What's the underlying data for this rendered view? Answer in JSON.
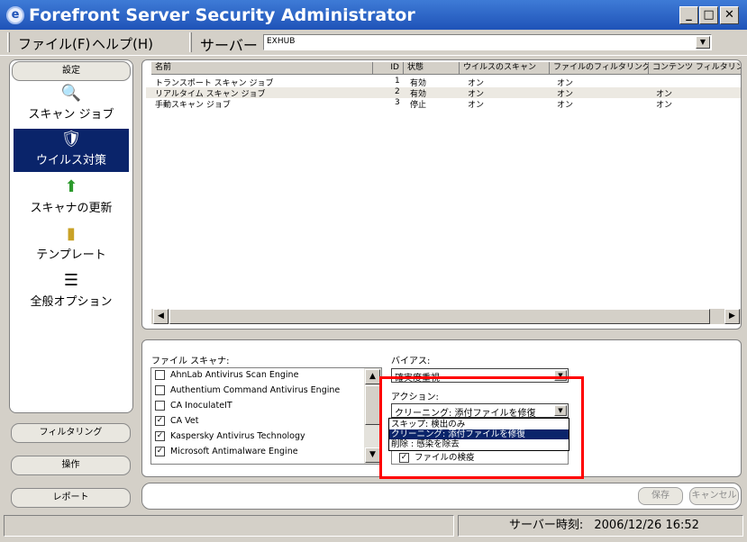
{
  "window": {
    "title": "Forefront Server Security Administrator",
    "min": "_",
    "max": "□",
    "close": "✕"
  },
  "menu": {
    "file": "ファイル(F)",
    "help": "ヘルプ(H)",
    "server_label": "サーバー",
    "server_value": "EXHUB"
  },
  "sidebar": {
    "settings_button": "設定",
    "nav": [
      {
        "label": "スキャン ジョブ",
        "icon": "scan-job-icon",
        "selected": false
      },
      {
        "label": "ウイルス対策",
        "icon": "antivirus-shield-icon",
        "selected": true
      },
      {
        "label": "スキャナの更新",
        "icon": "scanner-update-icon",
        "selected": false
      },
      {
        "label": "テンプレート",
        "icon": "template-icon",
        "selected": false
      },
      {
        "label": "全般オプション",
        "icon": "general-options-icon",
        "selected": false
      }
    ],
    "filtering_button": "フィルタリング",
    "operations_button": "操作",
    "report_button": "レポート"
  },
  "jobs": {
    "columns": [
      "名前",
      "ID",
      "状態",
      "ウイルスのスキャン",
      "ファイルのフィルタリング",
      "コンテンツ フィルタリング"
    ],
    "rows": [
      [
        "トランスポート スキャン ジョブ",
        "1",
        "有効",
        "オン",
        "オン",
        ""
      ],
      [
        "リアルタイム スキャン ジョブ",
        "2",
        "有効",
        "オン",
        "オン",
        "オン"
      ],
      [
        "手動スキャン ジョブ",
        "3",
        "停止",
        "オン",
        "オン",
        "オン"
      ]
    ]
  },
  "file_scanner": {
    "label": "ファイル スキャナ:",
    "engines": [
      {
        "name": "AhnLab Antivirus Scan Engine",
        "checked": false
      },
      {
        "name": "Authentium Command Antivirus Engine",
        "checked": false
      },
      {
        "name": "CA InoculateIT",
        "checked": false
      },
      {
        "name": "CA Vet",
        "checked": true
      },
      {
        "name": "Kaspersky Antivirus Technology",
        "checked": true
      },
      {
        "name": "Microsoft Antimalware Engine",
        "checked": true
      }
    ]
  },
  "bias": {
    "label": "バイアス:",
    "value": "確実度重視"
  },
  "action": {
    "label": "アクション:",
    "value": "クリーニング: 添付ファイルを修復",
    "options": [
      "スキップ: 検出のみ",
      "クリーニング: 添付ファイルを修復",
      "削除 : 感染を除去"
    ],
    "selected_index": 1
  },
  "partial_checkbox_label": "ファイルの検疫",
  "buttons": {
    "save": "保存",
    "cancel": "キャンセル"
  },
  "status": {
    "server_time_label": "サーバー時刻:",
    "server_time": "2006/12/26 16:52"
  },
  "colors": {
    "title_bar": "#2a62c9",
    "selection": "#0a246a",
    "highlight_box": "#ff0000"
  }
}
